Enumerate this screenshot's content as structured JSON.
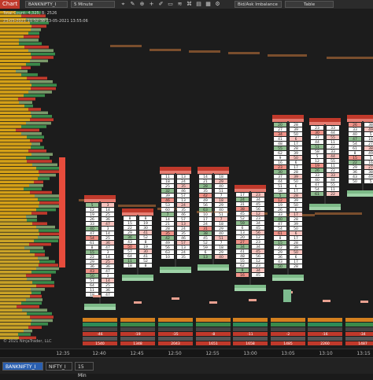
{
  "toolbar": {
    "window_label": "Chart",
    "instrument": "BANKNIFTY_I",
    "interval": "5 Minute",
    "indicator": "Bid/Ask Imbalance",
    "table_label": "Table"
  },
  "info": {
    "line1": "Total Count:  4,325, B: 2526",
    "line2": "23-05-2021 11:52:38  23-05-2021 13:55:06"
  },
  "copyright": "© 2021 NinjaTrader, LLC",
  "x_axis": {
    "labels": [
      "12:35",
      "12:40",
      "12:45",
      "12:50",
      "12:55",
      "13:00",
      "13:05",
      "13:10",
      "13:15"
    ]
  },
  "tabs": [
    {
      "label": "BANKNIFTY_I"
    },
    {
      "label": "NIFTY_I"
    },
    {
      "label": "15 Min"
    }
  ],
  "colors": {
    "buy": "#3a8a4a",
    "sell": "#c0392b",
    "profile": "#d4a017",
    "poc_line": "#7a4e2d"
  },
  "chart_data": {
    "type": "table",
    "x": [
      "12:40",
      "12:45",
      "12:50",
      "12:55",
      "13:00",
      "13:05",
      "13:10",
      "13:15"
    ],
    "footer_rows": {
      "delta": [
        "-46",
        "-19",
        "-35",
        "-8",
        "-11",
        "-2",
        "-16",
        "-34"
      ],
      "volume": [
        "1540",
        "1348",
        "2043",
        "1651",
        "1658",
        "1485",
        "2260",
        "1487"
      ]
    }
  }
}
